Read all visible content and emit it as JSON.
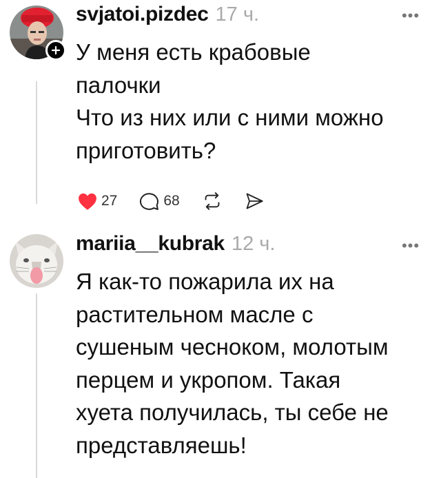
{
  "posts": [
    {
      "username": "svjatoi.pizdec",
      "time": "17 ч.",
      "lines": [
        "У меня есть крабовые",
        "палочки",
        "Что из них или с ними можно",
        "приготовить?"
      ],
      "likes": "27",
      "replies": "68"
    },
    {
      "username": "mariia__kubrak",
      "time": "12 ч.",
      "lines": [
        "Я как-то пожарила их на",
        "растительном масле с",
        "сушеным чесноком, молотым",
        "перцем и укропом. Такая",
        "хуета получилась, ты себе не",
        "представляешь!"
      ]
    }
  ],
  "icons": {
    "more": "more-horizontal-icon",
    "follow": "plus-icon",
    "like": "heart-filled-icon",
    "reply": "comment-bubble-icon",
    "repost": "repost-icon",
    "share": "send-icon"
  },
  "colors": {
    "like": "#ff3040",
    "muted": "#a9a9a9",
    "text": "#111111"
  }
}
